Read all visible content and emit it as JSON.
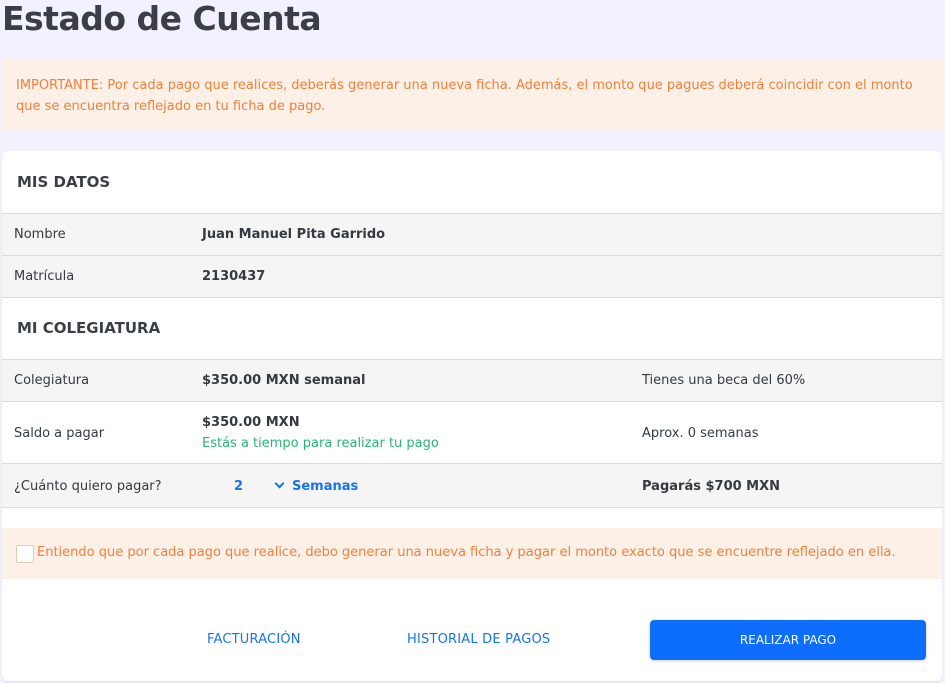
{
  "page_title": "Estado de Cuenta",
  "alert_text": "IMPORTANTE: Por cada pago que realices, deberás generar una nueva ficha. Además, el monto que pagues deberá coincidir con el monto que se encuentra reflejado en tu ficha de pago.",
  "mis_datos": {
    "title": "MIS DATOS",
    "rows": [
      {
        "label": "Nombre",
        "value": "Juan Manuel Pita Garrido"
      },
      {
        "label": "Matrícula",
        "value": "2130437"
      }
    ]
  },
  "mi_colegiatura": {
    "title": "MI COLEGIATURA",
    "colegiatura": {
      "label": "Colegiatura",
      "value": "$350.00 MXN semanal",
      "note": "Tienes una beca del 60%"
    },
    "saldo": {
      "label": "Saldo a pagar",
      "value": "$350.00 MXN",
      "status": "Estás a tiempo para realizar tu pago",
      "note": "Aprox. 0 semanas"
    },
    "cuanto": {
      "label": "¿Cuánto quiero pagar?",
      "quantity": "2",
      "unit": "Semanas",
      "total": "Pagarás $700 MXN"
    }
  },
  "confirm_text": "Entiendo que por cada pago que realice, debo generar una nueva ficha y pagar el monto exacto que se encuentre reflejado en ella.",
  "actions": {
    "facturacion": "FACTURACIÓN",
    "historial": "HISTORIAL DE PAGOS",
    "realizar_pago": "REALIZAR PAGO"
  },
  "colors": {
    "accent": "#0d6efd",
    "warning_text": "#f0803c",
    "warning_bg": "#fdf0e6",
    "success_text": "#28b673"
  }
}
